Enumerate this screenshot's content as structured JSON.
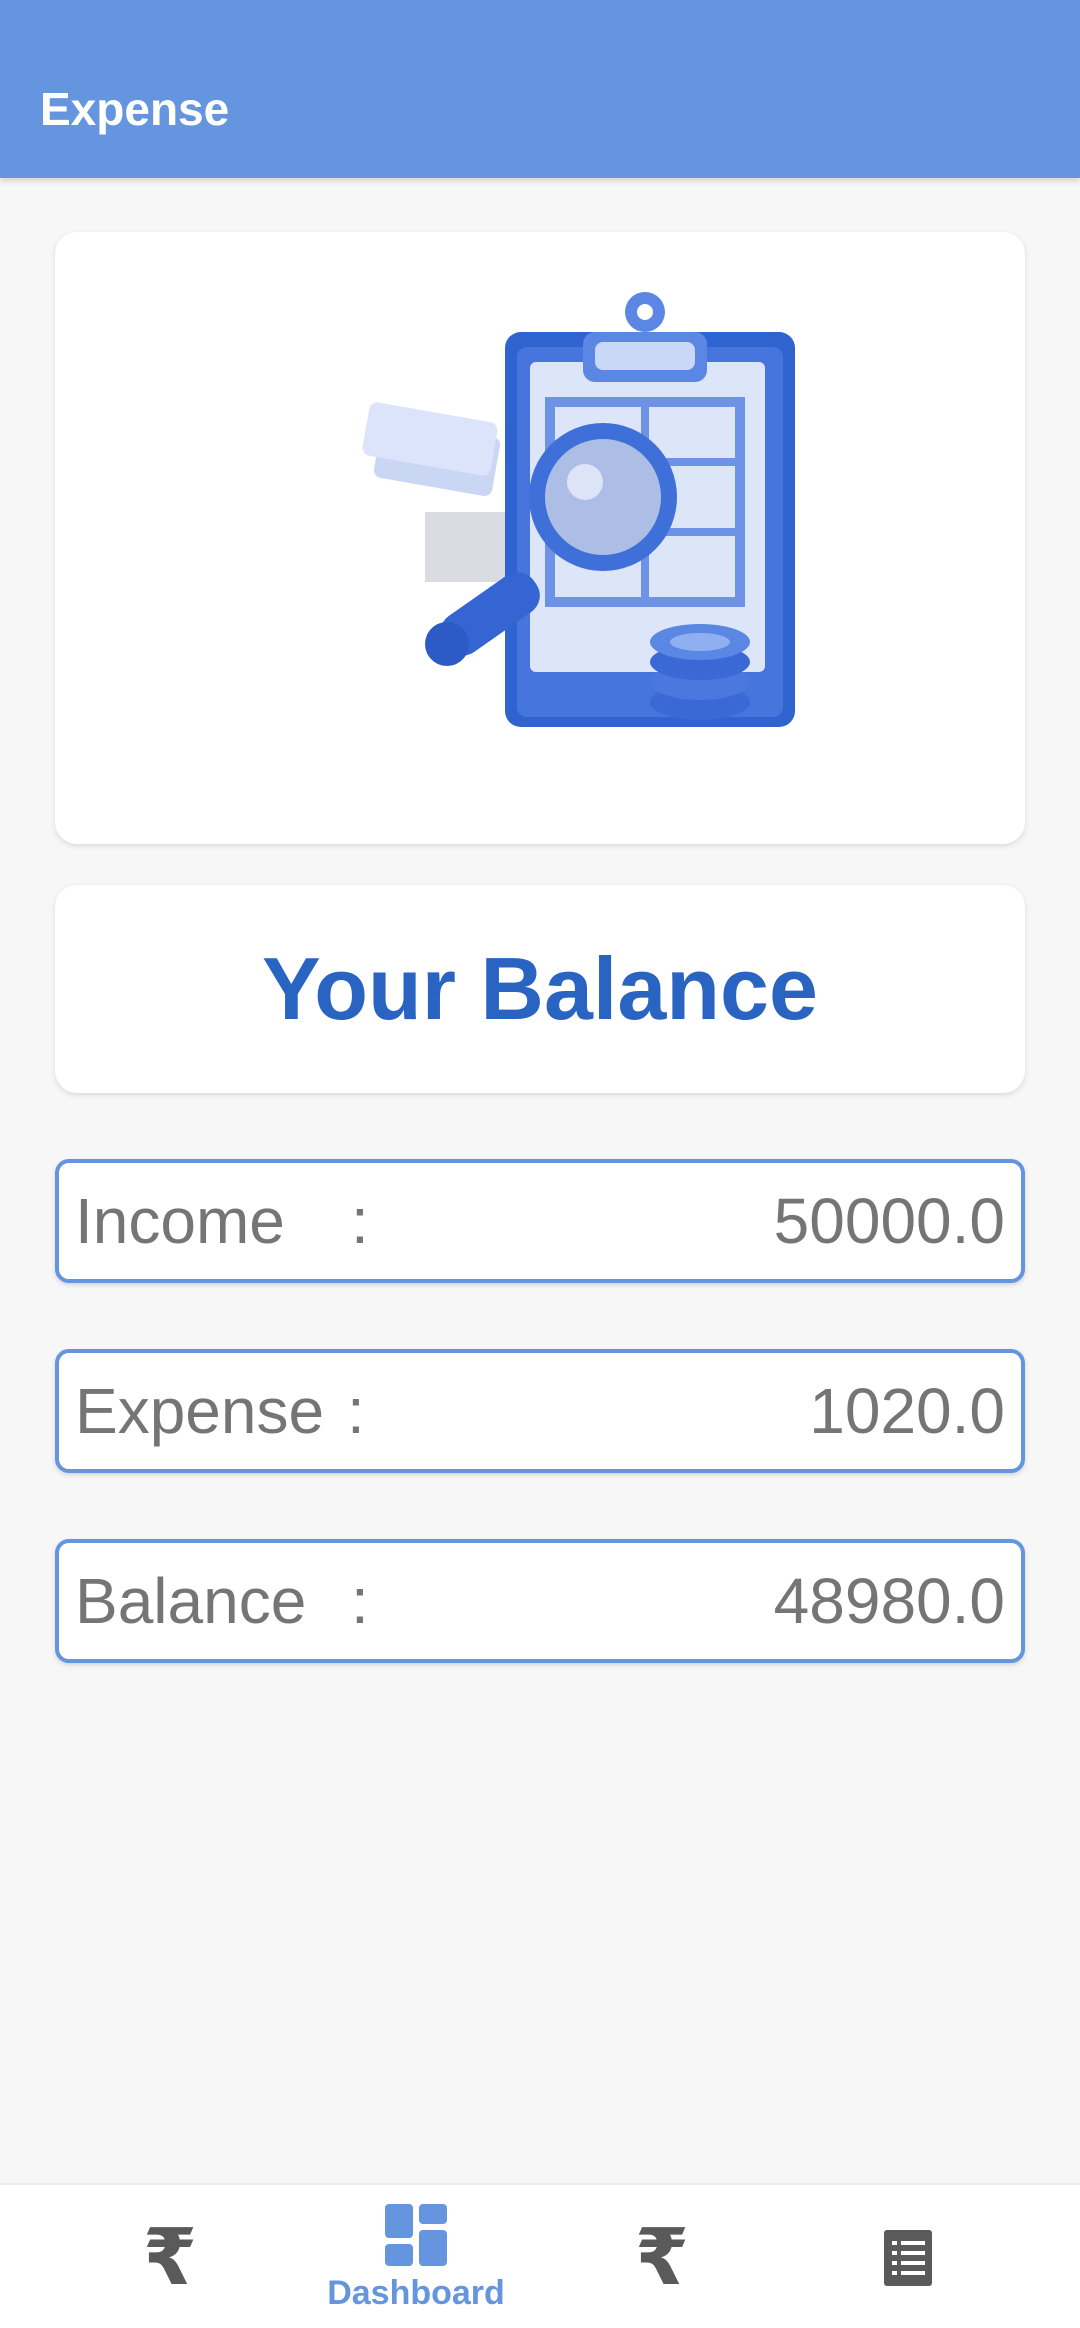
{
  "app_bar": {
    "title": "Expense"
  },
  "hero": {
    "illustration": "clipboard-magnifier-coins-illustration"
  },
  "balance_card": {
    "title": "Your Balance"
  },
  "rows": [
    {
      "label": "Income",
      "separator": ":",
      "value": "50000.0"
    },
    {
      "label": "Expense",
      "separator": ":",
      "value": "1020.0"
    },
    {
      "label": "Balance",
      "separator": ":",
      "value": "48980.0"
    }
  ],
  "bottom_nav": {
    "items": [
      {
        "icon": "rupee-icon",
        "glyph": "₹",
        "label": ""
      },
      {
        "icon": "dashboard-icon",
        "label": "Dashboard",
        "active": true
      },
      {
        "icon": "rupee-icon",
        "glyph": "₹",
        "label": ""
      },
      {
        "icon": "report-list-icon",
        "label": ""
      }
    ]
  },
  "colors": {
    "primary": "#6495de",
    "title_blue": "#2a64c2",
    "text_grey": "#757575",
    "icon_grey": "#5a5a5a",
    "background": "#f7f7f8"
  }
}
